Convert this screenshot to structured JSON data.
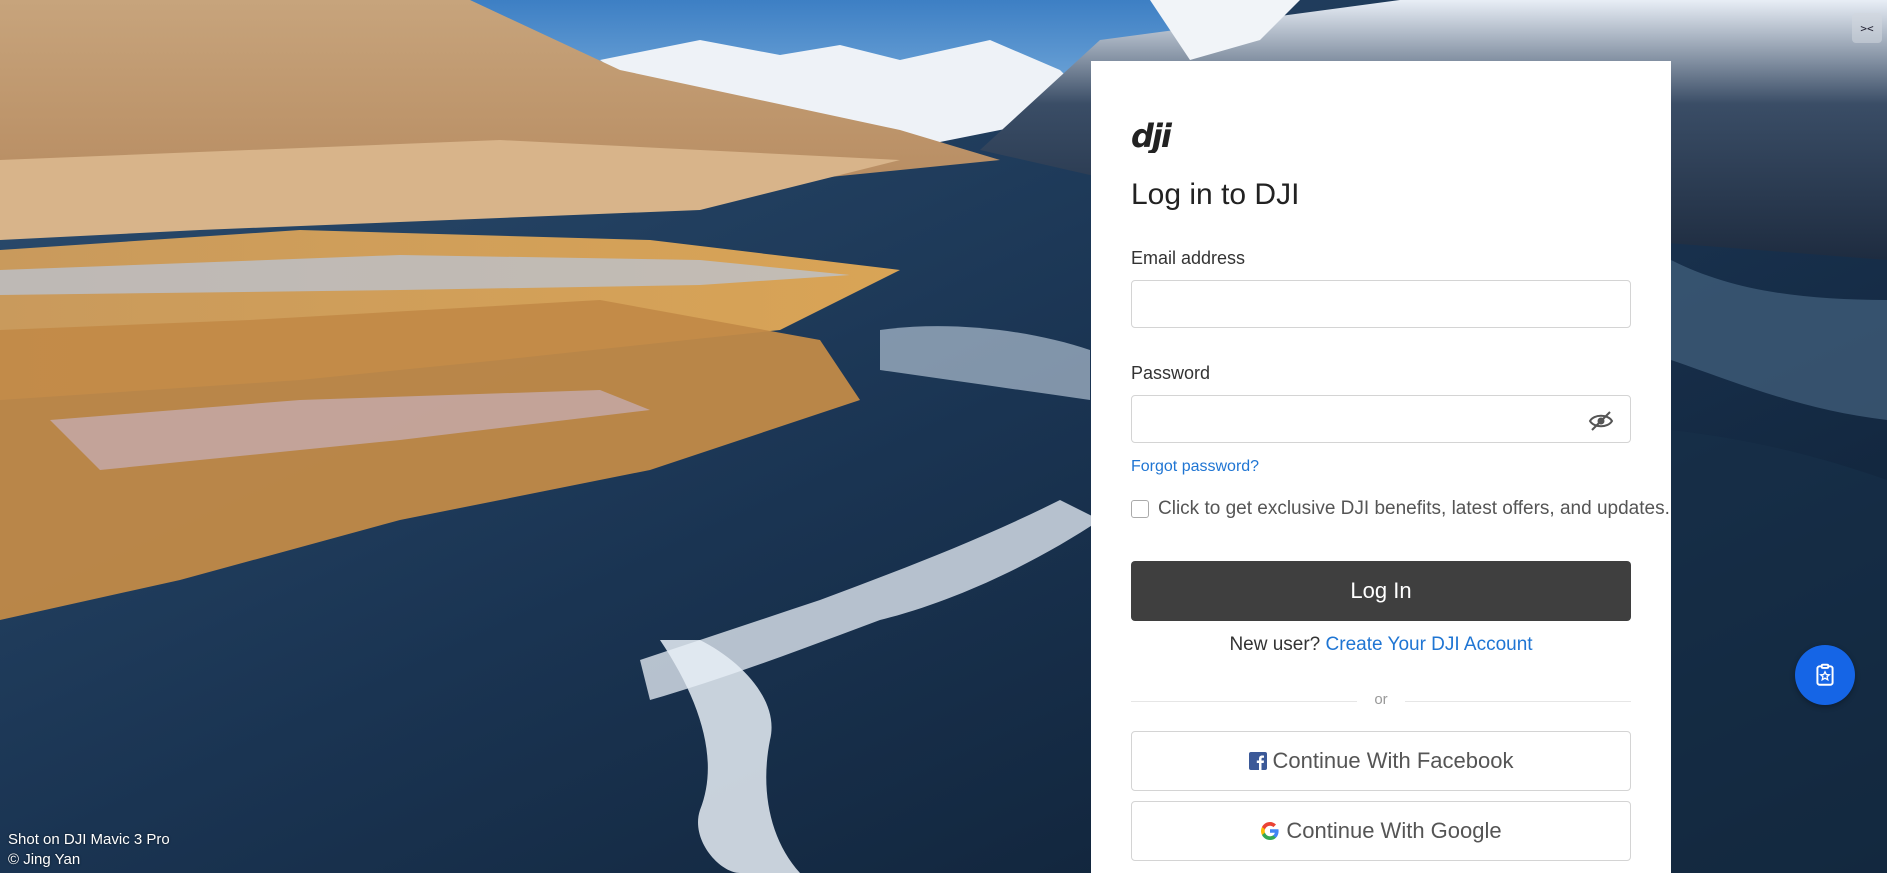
{
  "background": {
    "credit_line1": "Shot on DJI Mavic 3 Pro",
    "credit_line2": "© Jing Yan"
  },
  "corner_button": {
    "label": "><"
  },
  "login": {
    "brand": "dji",
    "title": "Log in to DJI",
    "email_label": "Email address",
    "email_value": "",
    "password_label": "Password",
    "password_value": "",
    "forgot_label": "Forgot password?",
    "consent_text": "Click to get exclusive DJI benefits, latest offers, and updates.",
    "consent_checked": false,
    "login_button": "Log In",
    "new_user_prefix": "New user?",
    "create_account_link": "Create Your DJI Account",
    "divider_text": "or",
    "facebook_button": "Continue With Facebook",
    "google_button": "Continue With Google"
  },
  "icons": {
    "password_toggle": "eye-off-icon",
    "facebook": "facebook-icon",
    "google": "google-icon",
    "floating_action": "clipboard-star-icon",
    "corner": "collapse-icon"
  },
  "colors": {
    "link": "#1f75d3",
    "primary_button": "#3f3f3f",
    "fab": "#1565e6",
    "facebook": "#3b5998"
  }
}
